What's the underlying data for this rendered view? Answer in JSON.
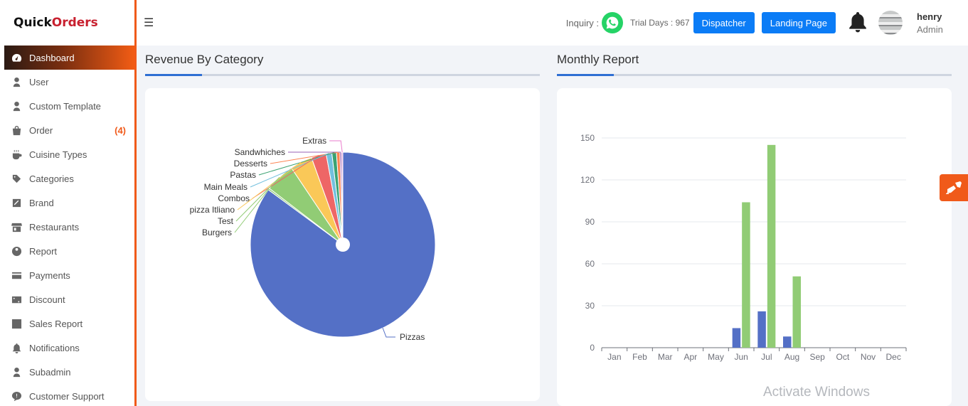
{
  "brand": {
    "part1": "Quick",
    "part2": "Orders"
  },
  "header": {
    "menu_icon": "hamburger-icon",
    "inquiry_label": "Inquiry :",
    "trial_label": "Trial Days : 967",
    "dispatcher_label": "Dispatcher",
    "landing_label": "Landing Page",
    "user_name": "henry",
    "user_role": "Admin"
  },
  "sidebar": {
    "items": [
      {
        "label": "Dashboard",
        "icon": "gauge-icon",
        "active": true
      },
      {
        "label": "User",
        "icon": "user-icon"
      },
      {
        "label": "Custom Template",
        "icon": "user-icon"
      },
      {
        "label": "Order",
        "icon": "bag-icon",
        "badge": "(4)"
      },
      {
        "label": "Cuisine Types",
        "icon": "cup-icon"
      },
      {
        "label": "Categories",
        "icon": "tag-icon"
      },
      {
        "label": "Brand",
        "icon": "brand-icon"
      },
      {
        "label": "Restaurants",
        "icon": "store-icon"
      },
      {
        "label": "Report",
        "icon": "report-icon"
      },
      {
        "label": "Payments",
        "icon": "card-icon"
      },
      {
        "label": "Discount",
        "icon": "discount-icon"
      },
      {
        "label": "Sales Report",
        "icon": "chart-icon"
      },
      {
        "label": "Notifications",
        "icon": "bell-icon"
      },
      {
        "label": "Subadmin",
        "icon": "user-icon"
      },
      {
        "label": "Customer Support",
        "icon": "chat-icon"
      }
    ]
  },
  "revenue_panel": {
    "title": "Revenue By Category"
  },
  "monthly_panel": {
    "title": "Monthly Report"
  },
  "watermark": "Activate Windows",
  "colors": {
    "accent": "#f05a1a",
    "button_blue": "#0b7cf6",
    "pie_main": "#5470c6",
    "bar_green": "#91cc75"
  },
  "chart_data": [
    {
      "type": "pie",
      "title": "Revenue By Category",
      "slices": [
        {
          "label": "Pizzas",
          "value": 85.1,
          "color": "#5470c6"
        },
        {
          "label": "Burgers",
          "value": 0.3,
          "color": "#91cc75"
        },
        {
          "label": "Test",
          "value": 5.2,
          "color": "#91cc75"
        },
        {
          "label": "pizza Itliano",
          "value": 3.9,
          "color": "#fac858"
        },
        {
          "label": "Combos",
          "value": 2.6,
          "color": "#ee6666"
        },
        {
          "label": "Main Meals",
          "value": 1.0,
          "color": "#73c0de"
        },
        {
          "label": "Pastas",
          "value": 0.8,
          "color": "#3ba272"
        },
        {
          "label": "Desserts",
          "value": 0.6,
          "color": "#fc8452"
        },
        {
          "label": "Sandwhiches",
          "value": 0.3,
          "color": "#9a60b4"
        },
        {
          "label": "Extras",
          "value": 0.2,
          "color": "#ea7ccc"
        }
      ]
    },
    {
      "type": "bar",
      "title": "Monthly Report",
      "categories": [
        "Jan",
        "Feb",
        "Mar",
        "Apr",
        "May",
        "Jun",
        "Jul",
        "Aug",
        "Sep",
        "Oct",
        "Nov",
        "Dec"
      ],
      "series": [
        {
          "values": [
            0,
            0,
            0,
            0,
            0,
            14,
            26,
            8,
            0,
            0,
            0,
            0
          ],
          "color": "#5470c6"
        },
        {
          "values": [
            0,
            0,
            0,
            0,
            0,
            104,
            145,
            51,
            0,
            0,
            0,
            0
          ],
          "color": "#91cc75"
        }
      ],
      "ylim": [
        0,
        150
      ],
      "yticks": [
        0,
        30,
        60,
        90,
        120,
        150
      ],
      "grid": true
    }
  ]
}
